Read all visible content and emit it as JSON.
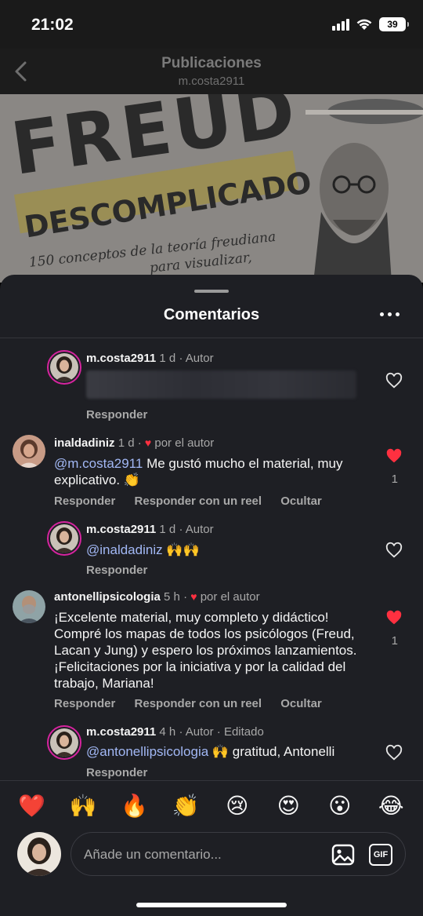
{
  "status": {
    "time": "21:02",
    "battery": "39"
  },
  "header": {
    "title": "Publicaciones",
    "subtitle": "m.costa2911"
  },
  "post": {
    "title": "FREUD",
    "subtitle": "DESCOMPLICADO",
    "line1": "150 conceptos de la teoría freudiana",
    "line2": "para visualizar,"
  },
  "sheet": {
    "title": "Comentarios"
  },
  "comments": [
    {
      "user": "m.costa2911",
      "time": "1 d",
      "tag": "· Autor",
      "text": "",
      "reply": "Responder"
    },
    {
      "user": "inaldadiniz",
      "time": "1 d",
      "by_author": "por el autor",
      "mention": "@m.costa2911",
      "text": " Me gustó mucho el material, muy explicativo. 👏",
      "reply": "Responder",
      "reel": "Responder con un reel",
      "hide": "Ocultar",
      "likes": "1"
    },
    {
      "user": "m.costa2911",
      "time": "1 d",
      "tag": "· Autor",
      "mention": "@inaldadiniz",
      "text": " 🙌🙌",
      "reply": "Responder"
    },
    {
      "user": "antonellipsicologia",
      "time": "5 h",
      "by_author": "por el autor",
      "text": "¡Excelente material, muy completo y didáctico! Compré los mapas de todos los psicólogos (Freud, Lacan y Jung) y espero los próximos lanzamientos. ¡Felicitaciones por la iniciativa y por la calidad del trabajo, Mariana!",
      "reply": "Responder",
      "reel": "Responder con un reel",
      "hide": "Ocultar",
      "likes": "1"
    },
    {
      "user": "m.costa2911",
      "time": "4 h",
      "tag": "· Autor · Editado",
      "mention": "@antonellipsicologia",
      "text": " 🙌 gratitud, Antonelli",
      "reply": "Responder"
    }
  ],
  "emojis": [
    "❤️",
    "🙌",
    "🔥",
    "👏",
    "😢",
    "😍",
    "😮",
    "😂"
  ],
  "input": {
    "placeholder": "Añade un comentario...",
    "gif": "GIF"
  },
  "colors": {
    "sheet_bg": "#1e1f24",
    "like_red": "#ff3040",
    "mention": "#a2b8f5",
    "story_ring": "#d6249f"
  }
}
